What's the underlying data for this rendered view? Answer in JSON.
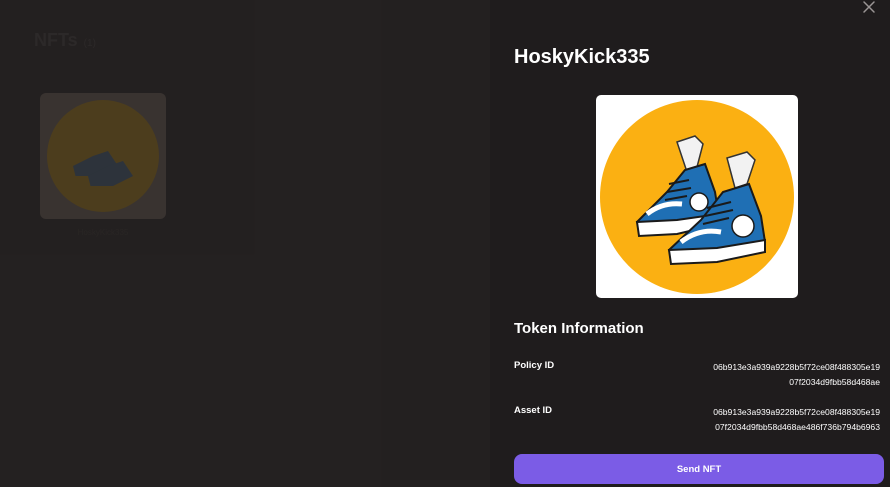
{
  "background": {
    "title": "NFTs",
    "count": "(1)",
    "card_label": "HoskyKick335"
  },
  "drawer": {
    "close_icon": "close-icon",
    "title": "HoskyKick335",
    "image_description_icon": "nft-sneakers-image",
    "section_title": "Token Information",
    "policy_id": {
      "label": "Policy ID",
      "value_line1": "06b913e3a939a9228b5f72ce08f488305e19",
      "value_line2": "07f2034d9fbb58d468ae"
    },
    "asset_id": {
      "label": "Asset ID",
      "value_line1": "06b913e3a939a9228b5f72ce08f488305e19",
      "value_line2": "07f2034d9fbb58d468ae486f736b794b6963"
    },
    "send_button": "Send NFT"
  },
  "colors": {
    "accent": "#7b5ce6",
    "nft_background": "#fbb012",
    "panel": "#1f1c1d"
  }
}
